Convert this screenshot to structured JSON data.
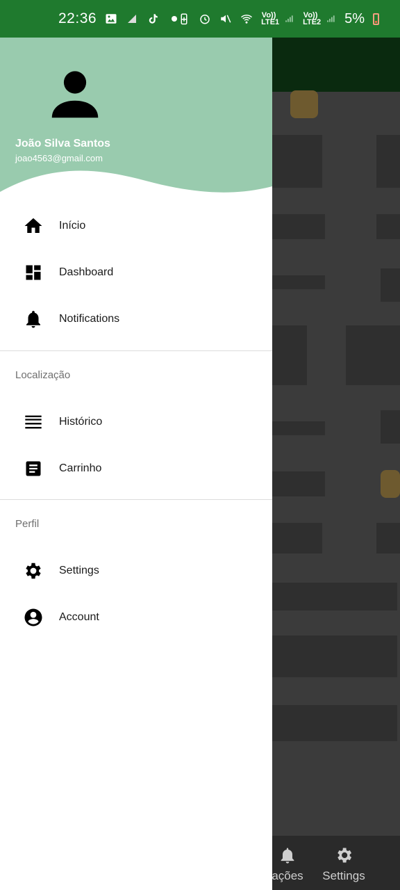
{
  "status_bar": {
    "time": "22:36",
    "battery_percent": "5%",
    "sim1_label": "Vo)) LTE1",
    "sim2_label": "Vo)) LTE2",
    "icons": [
      "gallery-icon",
      "signal-icon",
      "tiktok-icon",
      "dot-icon",
      "battery-saver-icon",
      "alarm-icon",
      "mute-icon",
      "wifi-icon",
      "sim1-icon",
      "sim2-icon",
      "battery-icon"
    ]
  },
  "drawer": {
    "header": {
      "name": "João Silva Santos",
      "email": "joao4563@gmail.com",
      "background_color": "#99cbae",
      "avatar_icon": "person-icon"
    },
    "main_items": [
      {
        "label": "Início",
        "icon": "home-icon"
      },
      {
        "label": "Dashboard",
        "icon": "dashboard-icon"
      },
      {
        "label": "Notifications",
        "icon": "bell-icon"
      }
    ],
    "sections": [
      {
        "title": "Localização",
        "items": [
          {
            "label": "Histórico",
            "icon": "list-icon"
          },
          {
            "label": "Carrinho",
            "icon": "article-icon"
          }
        ]
      },
      {
        "title": "Perfil",
        "items": [
          {
            "label": "Settings",
            "icon": "gear-icon"
          },
          {
            "label": "Account",
            "icon": "account-circle-icon"
          }
        ]
      }
    ]
  },
  "background_app": {
    "bottom_nav": [
      {
        "label": "ações",
        "icon": "bell-icon"
      },
      {
        "label": "Settings",
        "icon": "gear-icon"
      }
    ]
  },
  "colors": {
    "status_bar": "#1f7a2e",
    "header": "#99cbae",
    "scrim": "#3b3b3b"
  }
}
